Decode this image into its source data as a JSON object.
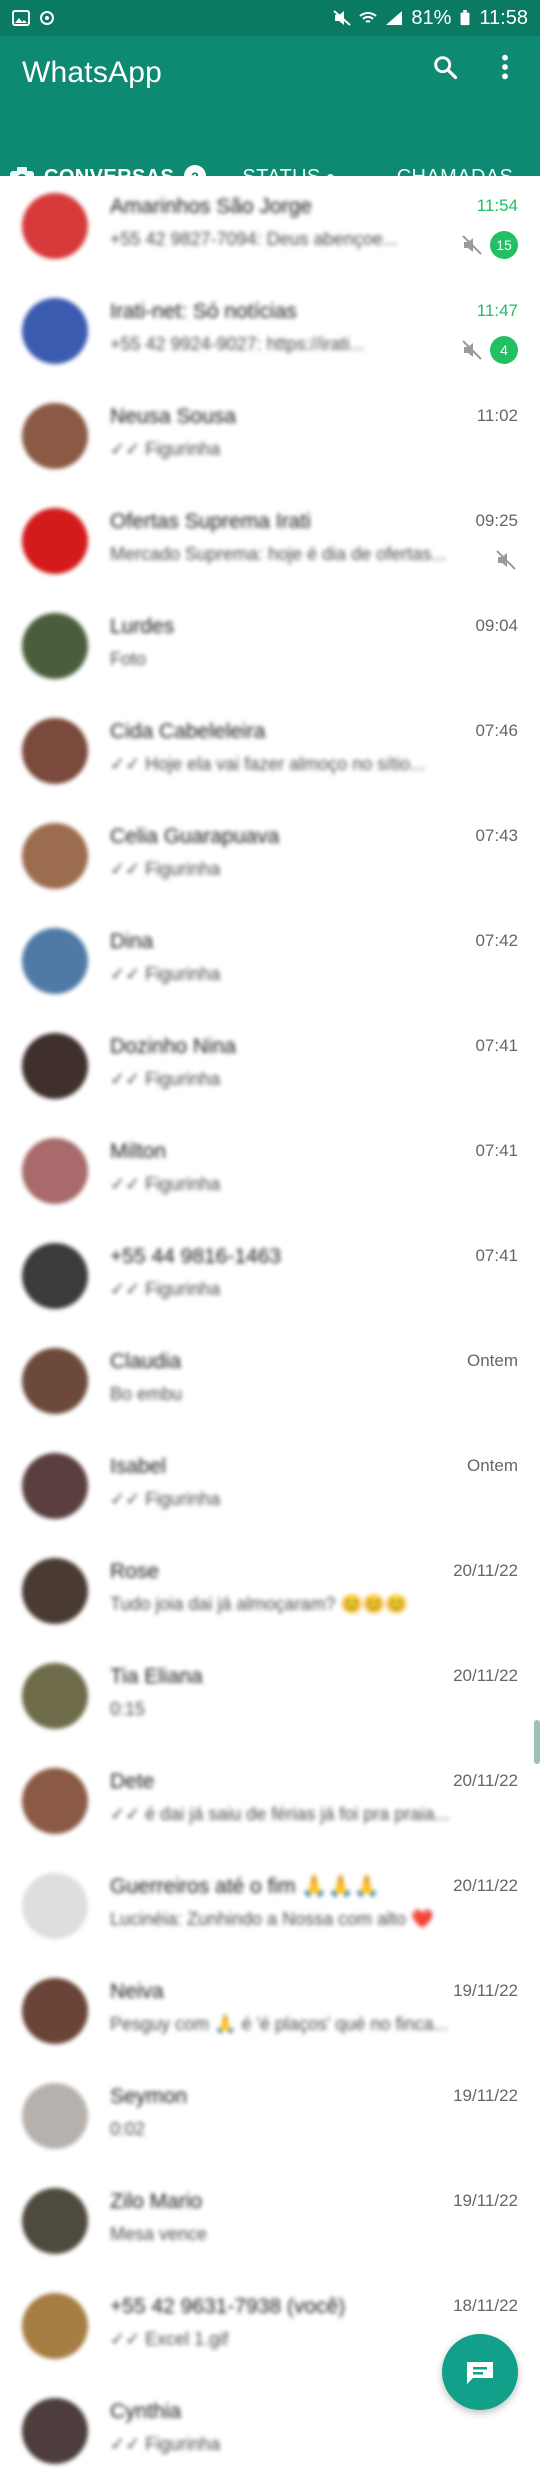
{
  "status_bar": {
    "battery": "81%",
    "time": "11:58",
    "icons": [
      "gallery-icon",
      "notification-icon",
      "mute-icon",
      "wifi-icon",
      "signal-icon",
      "battery-icon"
    ]
  },
  "app": {
    "title": "WhatsApp",
    "actions": [
      {
        "name": "search",
        "icon": "search-icon"
      },
      {
        "name": "more",
        "icon": "more-vert-icon"
      }
    ]
  },
  "tabs": [
    {
      "label": "CONVERSAS",
      "count": "2",
      "active": true
    },
    {
      "label": "STATUS",
      "dot": true,
      "active": false
    },
    {
      "label": "CHAMADAS",
      "active": false
    }
  ],
  "chats": [
    {
      "name": "Amarinhos São Jorge",
      "preview": "+55 42 9827-7094: Deus abençoe...",
      "time": "11:54",
      "unread": "15",
      "muted": true,
      "avatar_color": "#d63a3a"
    },
    {
      "name": "Irati-net: Só notícias",
      "preview": "+55 42 9924-9027: https://irati...",
      "time": "11:47",
      "unread": "4",
      "muted": true,
      "avatar_color": "#3b5bb1"
    },
    {
      "name": "Neusa Sousa",
      "preview": "✓✓ Figurinha",
      "time": "11:02",
      "avatar_color": "#8a5a45"
    },
    {
      "name": "Ofertas Suprema Irati",
      "preview": "Mercado Suprema: hoje é dia de ofertas...",
      "time": "09:25",
      "muted": true,
      "avatar_color": "#d41a1a"
    },
    {
      "name": "Lurdes",
      "preview": "Foto",
      "time": "09:04",
      "avatar_color": "#4b5e3b"
    },
    {
      "name": "Cida Cabeleleira",
      "preview": "✓✓ Hoje ela vai fazer almoço no sítio...",
      "time": "07:46",
      "avatar_color": "#7a4a3c"
    },
    {
      "name": "Celia Guarapuava",
      "preview": "✓✓ Figurinha",
      "time": "07:43",
      "avatar_color": "#9c6c4e"
    },
    {
      "name": "Dina",
      "preview": "✓✓ Figurinha",
      "time": "07:42",
      "avatar_color": "#4f7aa6"
    },
    {
      "name": "Dozinho Nina",
      "preview": "✓✓ Figurinha",
      "time": "07:41",
      "avatar_color": "#3f2f2d"
    },
    {
      "name": "Milton",
      "preview": "✓✓ Figurinha",
      "time": "07:41",
      "avatar_color": "#a86a6a"
    },
    {
      "name": "+55 44 9816-1463",
      "preview": "✓✓ Figurinha",
      "time": "07:41",
      "avatar_color": "#3d3a3a"
    },
    {
      "name": "Claudia",
      "preview": "Bo embu",
      "time": "Ontem",
      "avatar_color": "#6b4a3a"
    },
    {
      "name": "Isabel",
      "preview": "✓✓ Figurinha",
      "time": "Ontem",
      "avatar_color": "#5b3f3f"
    },
    {
      "name": "Rose",
      "preview": "Tudo joia dai já almoçaram? 😊😊😊",
      "time": "20/11/22",
      "avatar_color": "#4a3a34"
    },
    {
      "name": "Tia Eliana",
      "preview": "0:15",
      "time": "20/11/22",
      "avatar_color": "#6e6b4a"
    },
    {
      "name": "Dete",
      "preview": "✓✓ é dai já saiu de férias já foi pra praia...",
      "time": "20/11/22",
      "avatar_color": "#8b5a46"
    },
    {
      "name": "Guerreiros até o fim 🙏🙏🙏",
      "preview": "Lucinéia: Zunhindo a Nossa com alto ❤️",
      "time": "20/11/22",
      "avatar_color": "#dedede"
    },
    {
      "name": "Neiva",
      "preview": "Pesguy com 🙏 é 'é plaços' qué no finca...",
      "time": "19/11/22",
      "avatar_color": "#6a4436"
    },
    {
      "name": "Seymon",
      "preview": "0:02",
      "time": "19/11/22",
      "avatar_color": "#b7b1ad"
    },
    {
      "name": "Zilo Mario",
      "preview": "Mesa vence",
      "time": "19/11/22",
      "avatar_color": "#4e4a3e"
    },
    {
      "name": "+55 42 9631-7938 (você)",
      "preview": "✓✓ Excel 1.gif",
      "time": "18/11/22",
      "avatar_color": "#a67d42"
    },
    {
      "name": "Cynthia",
      "preview": "✓✓ Figurinha",
      "time": "",
      "avatar_color": "#4d3d3d"
    }
  ],
  "fab": {
    "icon": "new-chat-icon",
    "color": "#12a08a"
  },
  "colors": {
    "primary": "#0d8a71",
    "accent": "#21c063"
  }
}
